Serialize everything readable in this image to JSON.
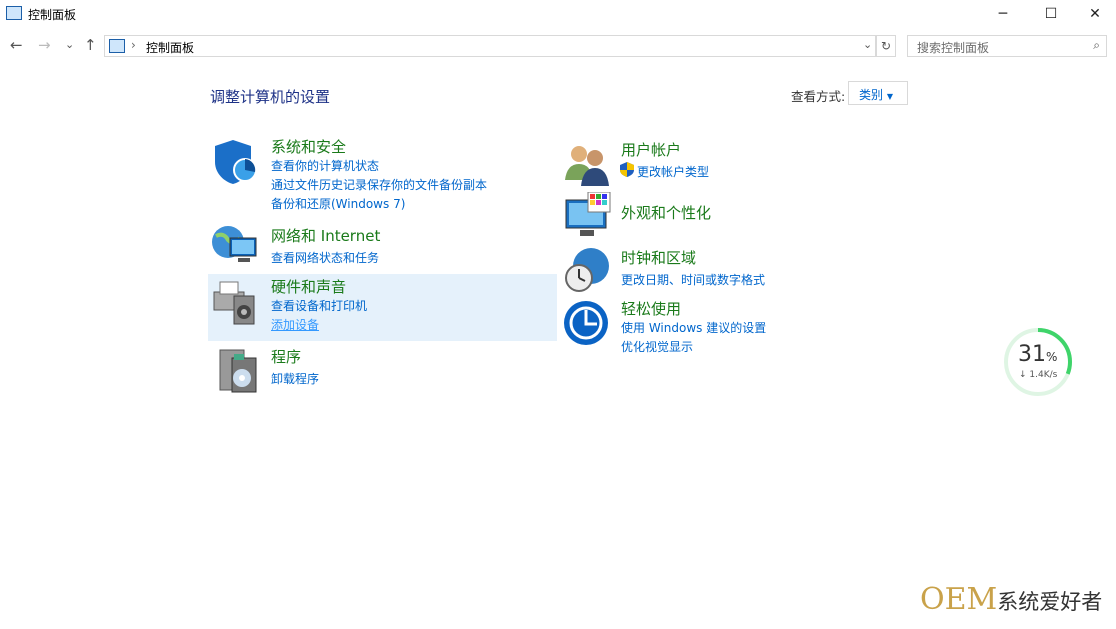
{
  "window": {
    "title": "控制面板",
    "minimize": "─",
    "maximize": "☐",
    "close": "✕"
  },
  "nav": {
    "back": "←",
    "forward": "→",
    "recent": "⌄",
    "up": "↑"
  },
  "address": {
    "separator": "›",
    "path": "控制面板",
    "dropdown": "⌄",
    "refresh": "↻"
  },
  "search": {
    "placeholder": "搜索控制面板",
    "icon": "⌕"
  },
  "main": {
    "heading": "调整计算机的设置",
    "view_label": "查看方式:",
    "view_value": "类别",
    "view_arrow": "▼"
  },
  "categories": [
    {
      "title": "系统和安全",
      "links": [
        "查看你的计算机状态",
        "通过文件历史记录保存你的文件备份副本",
        "备份和还原(Windows 7)"
      ]
    },
    {
      "title": "网络和 Internet",
      "links": [
        "查看网络状态和任务"
      ]
    },
    {
      "title": "硬件和声音",
      "links": [
        "查看设备和打印机",
        "添加设备"
      ]
    },
    {
      "title": "程序",
      "links": [
        "卸载程序"
      ]
    },
    {
      "title": "用户帐户",
      "links": [
        "更改帐户类型"
      ]
    },
    {
      "title": "外观和个性化",
      "links": []
    },
    {
      "title": "时钟和区域",
      "links": [
        "更改日期、时间或数字格式"
      ]
    },
    {
      "title": "轻松使用",
      "links": [
        "使用 Windows 建议的设置",
        "优化视觉显示"
      ]
    }
  ],
  "widget": {
    "percent": "31",
    "percent_sign": "%",
    "speed": "↓ 1.4K/s",
    "progress": 0.31
  },
  "watermark": {
    "brand": "OEM",
    "text": "系统爱好者"
  }
}
